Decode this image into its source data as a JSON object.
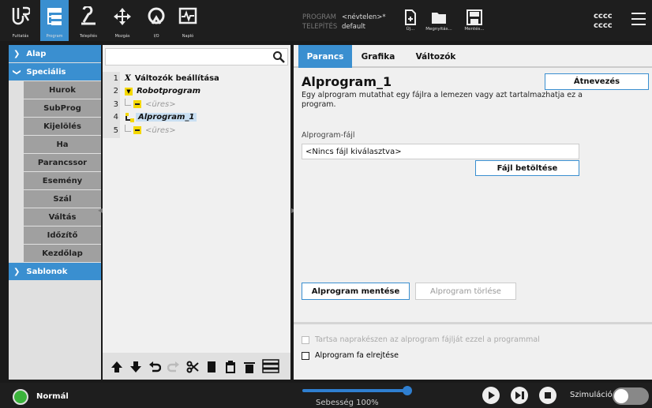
{
  "topbar": {
    "nav": [
      {
        "label": "Futtatás",
        "icon": "ur-logo-icon"
      },
      {
        "label": "Program",
        "icon": "program-tree-icon",
        "active": true
      },
      {
        "label": "Telepítés",
        "icon": "installation-icon"
      },
      {
        "label": "Mozgás",
        "icon": "move-icon"
      },
      {
        "label": "I/O",
        "icon": "io-icon"
      },
      {
        "label": "Napló",
        "icon": "log-icon"
      }
    ],
    "program_label": "PROGRAM",
    "program_value": "<névtelen>*",
    "install_label": "TELEPÍTÉS",
    "install_value": "default",
    "file_new": "Új...",
    "file_open": "Megnyitás...",
    "file_save": "Mentés...",
    "user_line1": "cccc",
    "user_line2": "cccc"
  },
  "leftnav": {
    "alap": "Alap",
    "specialis": "Speciális",
    "items": [
      "Hurok",
      "SubProg",
      "Kijelölés",
      "Ha",
      "Parancssor",
      "Esemény",
      "Szál",
      "Váltás",
      "Időzítő",
      "Kezdőlap"
    ],
    "sablonok": "Sablonok"
  },
  "tree": {
    "search_value": "",
    "rows": [
      {
        "num": "1",
        "label": "Változók beállítása"
      },
      {
        "num": "2",
        "label": "Robotprogram"
      },
      {
        "num": "3",
        "label": "<üres>"
      },
      {
        "num": "4",
        "label": "Alprogram_1"
      },
      {
        "num": "5",
        "label": "<üres>"
      }
    ]
  },
  "right": {
    "tabs": [
      "Parancs",
      "Grafika",
      "Változók"
    ],
    "title": "Alprogram_1",
    "rename": "Átnevezés",
    "desc": "Egy alprogram mutathat egy fájlra a lemezen vagy azt tartalmazhatja ez a program.",
    "file_label": "Alprogram-fájl",
    "file_value": "<Nincs fájl kiválasztva>",
    "load_btn": "Fájl betöltése",
    "save_btn": "Alprogram mentése",
    "delete_btn": "Alprogram törlése",
    "chk_keep": "Tartsa naprakészen az alprogram fájlját ezzel a programmal",
    "chk_hide": "Alprogram fa elrejtése"
  },
  "bottom": {
    "mode": "Normál",
    "speed": "Sebesség 100%",
    "speed_value": 100,
    "sim": "Szimuláció"
  }
}
